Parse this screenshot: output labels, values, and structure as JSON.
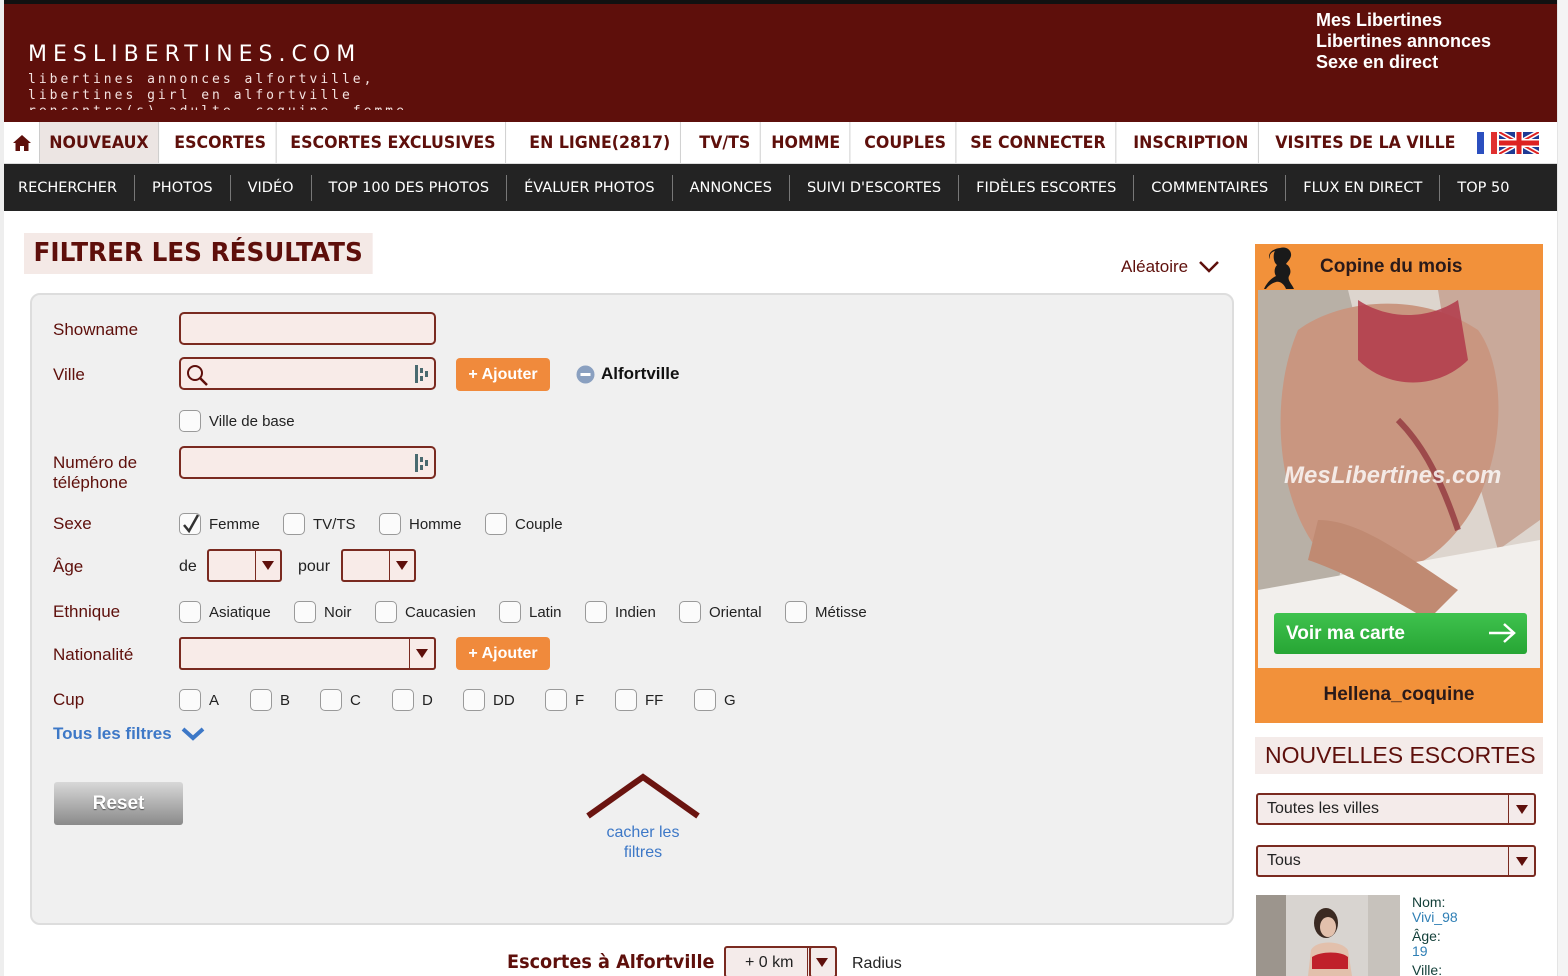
{
  "header": {
    "logo": "MESLIBERTINES.COM",
    "tagline": "libertines annonces alfortville, libertines girl en alfortville rencontre(s) adulte, coquine, femme",
    "links": [
      "Mes Libertines",
      "Libertines annonces",
      "Sexe en direct"
    ]
  },
  "nav_main": [
    "NOUVEAUX",
    "ESCORTES",
    "ESCORTES EXCLUSIVES",
    "EN LIGNE(2817)",
    "TV/TS",
    "HOMME",
    "COUPLES",
    "SE CONNECTER",
    "INSCRIPTION",
    "VISITES DE LA VILLE"
  ],
  "nav_main_active": "NOUVEAUX",
  "nav_sub": [
    "RECHERCHER",
    "PHOTOS",
    "VIDÉO",
    "TOP 100 DES PHOTOS",
    "ÉVALUER PHOTOS",
    "ANNONCES",
    "SUIVI D'ESCORTES",
    "FIDÈLES ESCORTES",
    "COMMENTAIRES",
    "FLUX EN DIRECT",
    "TOP 50"
  ],
  "filter": {
    "title": "FILTRER LES RÉSULTATS",
    "sort": "Aléatoire",
    "showname_label": "Showname",
    "showname_value": "",
    "ville_label": "Ville",
    "ville_value": "",
    "add_label": "+ Ajouter",
    "selected_city": "Alfortville",
    "ville_base_label": "Ville de base",
    "phone_label_1": "Numéro de",
    "phone_label_2": "téléphone",
    "phone_value": "",
    "sexe_label": "Sexe",
    "sexe_options": [
      {
        "label": "Femme",
        "checked": true
      },
      {
        "label": "TV/TS",
        "checked": false
      },
      {
        "label": "Homme",
        "checked": false
      },
      {
        "label": "Couple",
        "checked": false
      }
    ],
    "age_label": "Âge",
    "age_from_label": "de",
    "age_to_label": "pour",
    "ethnique_label": "Ethnique",
    "ethnique_options": [
      "Asiatique",
      "Noir",
      "Caucasien",
      "Latin",
      "Indien",
      "Oriental",
      "Métisse"
    ],
    "nationalite_label": "Nationalité",
    "cup_label": "Cup",
    "cup_options": [
      "A",
      "B",
      "C",
      "D",
      "DD",
      "F",
      "FF",
      "G"
    ],
    "all_filters": "Tous les filtres",
    "reset": "Reset",
    "hide_1": "cacher les",
    "hide_2": "filtres"
  },
  "results": {
    "title": "Escortes à Alfortville",
    "radius_value": "+ 0 km",
    "radius_label": "Radius"
  },
  "sidebar": {
    "featured_title": "Copine du mois",
    "watermark": "MesLibertines.com",
    "map_button": "Voir ma carte",
    "featured_name": "Hellena_coquine",
    "new_title": "NOUVELLES ESCORTES",
    "city_select": "Toutes les villes",
    "type_select": "Tous",
    "profile": {
      "nom_label": "Nom:",
      "nom": "Vivi_98",
      "age_label": "Âge:",
      "age": "19",
      "ville_label": "Ville:"
    }
  },
  "colors": {
    "brand": "#5e0f0b",
    "accent": "#f08a3c",
    "sidebar_orange": "#f2913a",
    "map_green": "#2eb03d",
    "link_blue": "#3d78c7"
  }
}
